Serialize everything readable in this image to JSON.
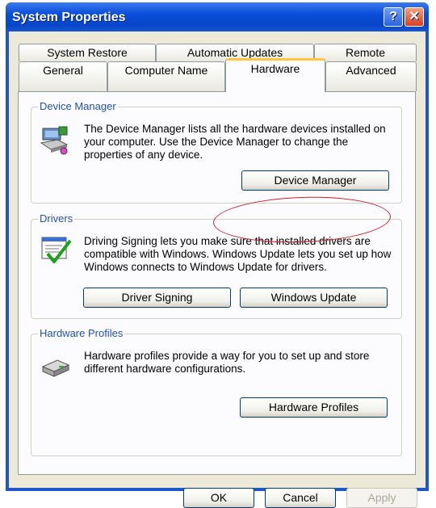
{
  "window": {
    "title": "System Properties",
    "help_glyph": "?",
    "close_glyph": "✕"
  },
  "tabs": {
    "row_top": [
      "System Restore",
      "Automatic Updates",
      "Remote"
    ],
    "row_bottom": [
      "General",
      "Computer Name",
      "Hardware",
      "Advanced"
    ],
    "active": "Hardware"
  },
  "groups": {
    "device_manager": {
      "label": "Device Manager",
      "text": "The Device Manager lists all the hardware devices installed on your computer. Use the Device Manager to change the properties of any device.",
      "button": "Device Manager",
      "icon": "device-manager-icon"
    },
    "drivers": {
      "label": "Drivers",
      "text": "Driving Signing lets you make sure that installed drivers are compatible with Windows. Windows Update lets you set up how Windows connects to Windows Update for drivers.",
      "button_signing": "Driver Signing",
      "button_update": "Windows Update",
      "icon": "driver-signing-icon"
    },
    "profiles": {
      "label": "Hardware Profiles",
      "text": "Hardware profiles provide a way for you to set up and store different hardware configurations.",
      "button": "Hardware Profiles",
      "icon": "hardware-profile-icon"
    }
  },
  "footer": {
    "ok": "OK",
    "cancel": "Cancel",
    "apply": "Apply"
  },
  "colors": {
    "title_blue": "#0a4dd8",
    "highlight_ellipse": "#cc2030",
    "tab_accent": "#ffc73c"
  }
}
